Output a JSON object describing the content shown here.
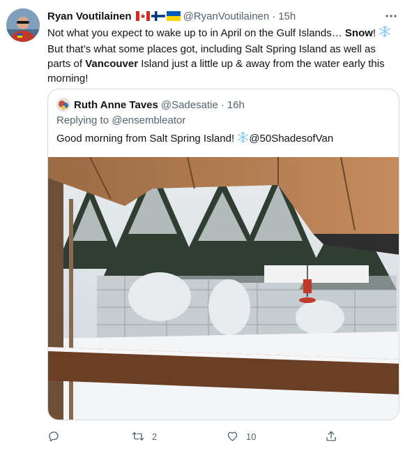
{
  "tweet": {
    "author_name": "Ryan Voutilainen",
    "author_handle": "@RyanVoutilainen",
    "separator": "·",
    "time": "15h",
    "flags": [
      "flag-canada-icon",
      "flag-finland-icon",
      "flag-ukraine-icon"
    ],
    "body": {
      "line1_a": "Not what you expect to wake up to in April on the Gulf Islands… ",
      "line1_bold": "Snow",
      "line1_b": "! ",
      "line2": "But that’s what some places got, including Salt Spring Island as well as",
      "line3_a": "parts of ",
      "line3_bold": "Vancouver",
      "line3_b": " Island just a little up & away from the water early this",
      "line4": "morning!"
    }
  },
  "quoted": {
    "author_name": "Ruth Anne Taves",
    "author_handle": "@Sadesatie",
    "separator": "·",
    "time": "16h",
    "replying_to": "Replying to @ensembleator",
    "text_a": "Good morning from Salt Spring Island! ",
    "text_b": "@50ShadesofVan"
  },
  "actions": {
    "reply_count": "",
    "retweet_count": "2",
    "like_count": "10"
  },
  "colors": {
    "text_primary": "#0f1419",
    "text_secondary": "#536471",
    "border": "#cfd9de",
    "snowflake": "#8ecdf8"
  }
}
